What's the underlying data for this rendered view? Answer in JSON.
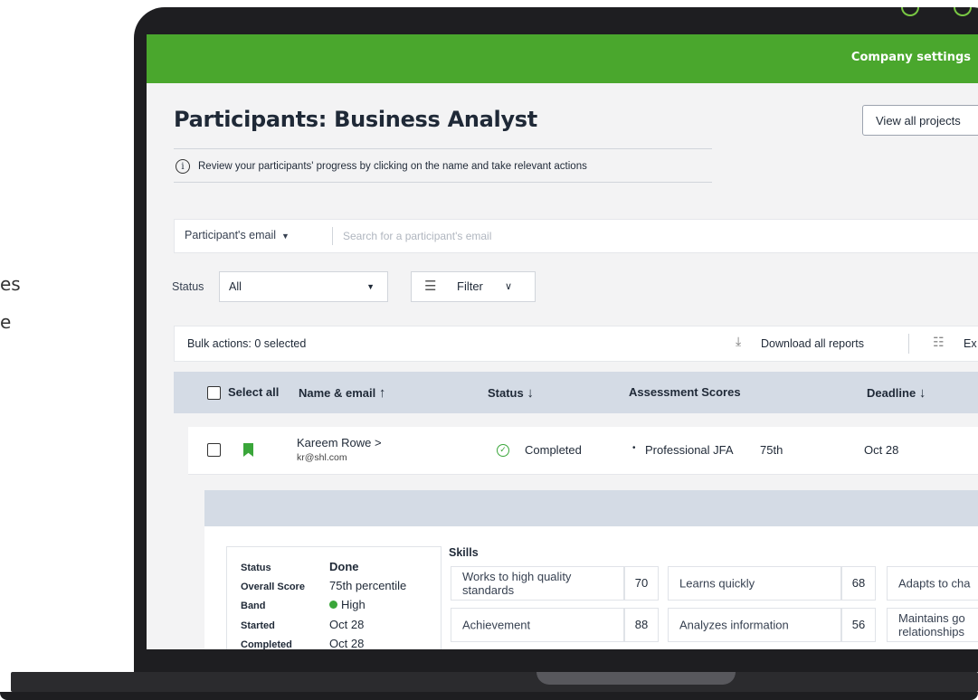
{
  "side_text": [
    "es",
    "e"
  ],
  "header": {
    "company_settings": "Company settings"
  },
  "page": {
    "title": "Participants: Business Analyst",
    "view_all_projects": "View all projects",
    "info_text": "Review your participants' progress by clicking on the name and take relevant actions"
  },
  "search": {
    "field_selector": "Participant's email",
    "placeholder": "Search for a participant's email"
  },
  "filters": {
    "status_label": "Status",
    "status_value": "All",
    "filter_label": "Filter"
  },
  "bulk": {
    "label": "Bulk actions: 0 selected",
    "download": "Download all reports",
    "export": "Ex"
  },
  "table": {
    "headers": {
      "select_all": "Select all",
      "name": "Name & email",
      "status": "Status",
      "scores": "Assessment Scores",
      "deadline": "Deadline"
    },
    "row": {
      "name": "Kareem Rowe >",
      "email": "kr@shl.com",
      "status": "Completed",
      "assessment": "Professional JFA",
      "percentile": "75th",
      "deadline": "Oct 28"
    }
  },
  "detail": {
    "stats": [
      {
        "key": "Status",
        "value": "Done"
      },
      {
        "key": "Overall Score",
        "value": "75th percentile"
      },
      {
        "key": "Band",
        "value": "High"
      },
      {
        "key": "Started",
        "value": "Oct 28"
      },
      {
        "key": "Completed",
        "value": "Oct 28"
      }
    ],
    "skills_title": "Skills",
    "skills": [
      {
        "name": "Works to high quality standards",
        "score": "70"
      },
      {
        "name": "Learns quickly",
        "score": "68"
      },
      {
        "name": "Adapts to cha"
      },
      {
        "name": "Achievement",
        "score": "88"
      },
      {
        "name": "Analyzes information",
        "score": "56"
      },
      {
        "name": "Maintains go relationships"
      }
    ]
  },
  "colors": {
    "brand_green": "#4aa72d",
    "header_blue": "#d4dbe5"
  }
}
